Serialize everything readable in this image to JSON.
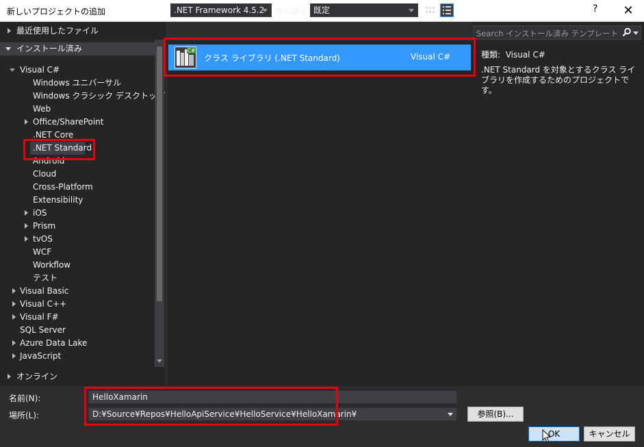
{
  "window": {
    "title": "新しいプロジェクトの追加",
    "help_label": "?",
    "close_label": "✕"
  },
  "tree": {
    "recent": "最近使用したファイル",
    "installed": "インストール済み",
    "visual_csharp": "Visual C#",
    "csharp_items": [
      "Windows ユニバーサル",
      "Windows クラシック デスクトップ",
      "Web",
      "Office/SharePoint",
      ".NET Core",
      ".NET Standard",
      "Android",
      "Cloud",
      "Cross-Platform",
      "Extensibility",
      "iOS",
      "Prism",
      "tvOS",
      "WCF",
      "Workflow",
      "テスト"
    ],
    "other_langs": [
      "Visual Basic",
      "Visual C++",
      "Visual F#",
      "SQL Server",
      "Azure Data Lake",
      "JavaScript"
    ],
    "online": "オンライン"
  },
  "toolbar": {
    "framework": ".NET Framework 4.5.2",
    "sort_label": "並べ替え:",
    "sort_value": "既定"
  },
  "template": {
    "name": "クラス ライブラリ (.NET Standard)",
    "lang": "Visual C#",
    "icon": "class-library-icon"
  },
  "search": {
    "placeholder": "Search インストール済み テンプレート (Ctrl+E)"
  },
  "info": {
    "type_label": "種類:",
    "type_value": "Visual C#",
    "description": ".NET Standard を対象とするクラス ライブラリを作成するためのプロジェクトです。"
  },
  "form": {
    "name_label": "名前(N):",
    "name_value": "HelloXamarin",
    "location_label": "場所(L):",
    "location_value": "D:¥Source¥Repos¥HelloApiService¥HelloService¥HelloXamarin¥",
    "browse_label": "参照(B)...",
    "ok_label": "OK",
    "cancel_label": "キャンセル"
  },
  "colors": {
    "accent": "#3399ff",
    "highlight": "#e8000b",
    "background": "#2d2d30",
    "panel": "#252526"
  }
}
